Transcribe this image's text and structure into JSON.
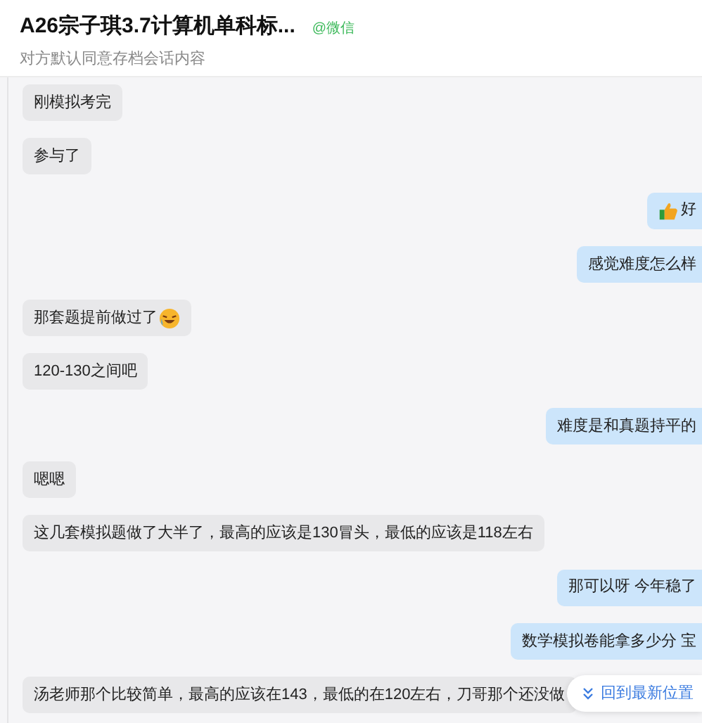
{
  "header": {
    "title": "A26宗子琪3.7计算机单科标...",
    "source": "@微信",
    "subtitle": "对方默认同意存档会话内容"
  },
  "messages": [
    {
      "outgoing": false,
      "text": "刚模拟考完"
    },
    {
      "outgoing": false,
      "text": "参与了"
    },
    {
      "outgoing": true,
      "text": "好",
      "emoji_before": true
    },
    {
      "outgoing": true,
      "text": "感觉难度怎么样"
    },
    {
      "outgoing": false,
      "text": "那套题提前做过了",
      "emoji_after": true
    },
    {
      "outgoing": false,
      "text": "120-130之间吧"
    },
    {
      "outgoing": true,
      "text": "难度是和真题持平的"
    },
    {
      "outgoing": false,
      "text": "嗯嗯"
    },
    {
      "outgoing": false,
      "text": "这几套模拟题做了大半了，最高的应该是130冒头，最低的应该是118左右"
    },
    {
      "outgoing": true,
      "text": "那可以呀 今年稳了"
    },
    {
      "outgoing": true,
      "text": "数学模拟卷能拿多少分 宝"
    },
    {
      "outgoing": false,
      "text": "汤老师那个比较简单，最高的应该在143，最低的在120左右，刀哥那个还没做"
    }
  ],
  "jump_button": {
    "label": "回到最新位置"
  }
}
